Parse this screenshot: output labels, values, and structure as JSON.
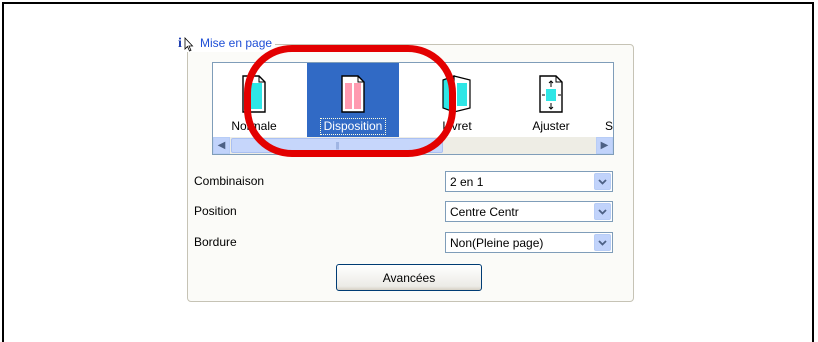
{
  "group": {
    "title": "Mise en page",
    "icon": "info-cursor-icon"
  },
  "layout_items": [
    {
      "label": "Normale",
      "icon": "page-normal-icon",
      "selected": false
    },
    {
      "label": "Disposition",
      "icon": "page-layout-icon",
      "selected": true
    },
    {
      "label": "Livret",
      "icon": "booklet-icon",
      "selected": false
    },
    {
      "label": "Ajuster",
      "icon": "fit-page-icon",
      "selected": false
    },
    {
      "label": "S",
      "icon": "partial-item-icon",
      "selected": false
    }
  ],
  "fields": [
    {
      "label": "Combinaison",
      "value": "2 en 1"
    },
    {
      "label": "Position",
      "value": "Centre Centr"
    },
    {
      "label": "Bordure",
      "value": "Non(Pleine page)"
    }
  ],
  "advanced_button": {
    "label": "Avancées"
  },
  "colors": {
    "selection": "#316ac5",
    "link": "#1f4fd6",
    "highlight": "#e30000"
  }
}
